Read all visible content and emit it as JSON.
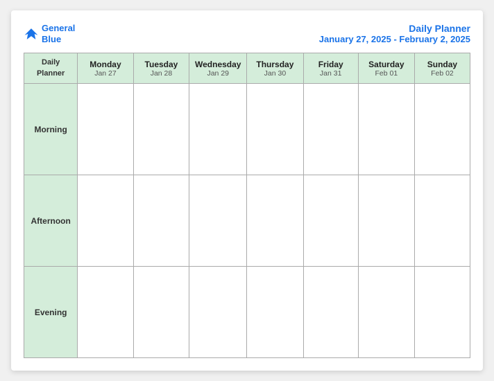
{
  "header": {
    "logo_line1": "General",
    "logo_line2": "Blue",
    "title_line1": "Daily Planner",
    "title_line2": "January 27, 2025 - February 2, 2025"
  },
  "table": {
    "header_first_line1": "Daily",
    "header_first_line2": "Planner",
    "columns": [
      {
        "day": "Monday",
        "date": "Jan 27"
      },
      {
        "day": "Tuesday",
        "date": "Jan 28"
      },
      {
        "day": "Wednesday",
        "date": "Jan 29"
      },
      {
        "day": "Thursday",
        "date": "Jan 30"
      },
      {
        "day": "Friday",
        "date": "Jan 31"
      },
      {
        "day": "Saturday",
        "date": "Feb 01"
      },
      {
        "day": "Sunday",
        "date": "Feb 02"
      }
    ],
    "rows": [
      {
        "label": "Morning"
      },
      {
        "label": "Afternoon"
      },
      {
        "label": "Evening"
      }
    ]
  }
}
